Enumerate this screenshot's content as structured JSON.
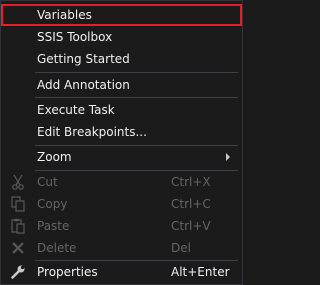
{
  "menu": {
    "items": [
      {
        "label": "Variables"
      },
      {
        "label": "SSIS Toolbox"
      },
      {
        "label": "Getting Started"
      },
      {
        "label": "Add Annotation"
      },
      {
        "label": "Execute Task"
      },
      {
        "label": "Edit Breakpoints..."
      },
      {
        "label": "Zoom"
      },
      {
        "label": "Cut",
        "shortcut": "Ctrl+X",
        "icon": "scissors-icon"
      },
      {
        "label": "Copy",
        "shortcut": "Ctrl+C",
        "icon": "copy-icon"
      },
      {
        "label": "Paste",
        "shortcut": "Ctrl+V",
        "icon": "paste-icon"
      },
      {
        "label": "Delete",
        "shortcut": "Del",
        "icon": "delete-x-icon"
      },
      {
        "label": "Properties",
        "shortcut": "Alt+Enter",
        "icon": "wrench-icon"
      }
    ]
  },
  "colors": {
    "background": "#1b1b1c",
    "text": "#f1f1f1",
    "disabled_text": "#656565",
    "highlight_border": "#e0202a",
    "separator": "#3f3f46"
  }
}
